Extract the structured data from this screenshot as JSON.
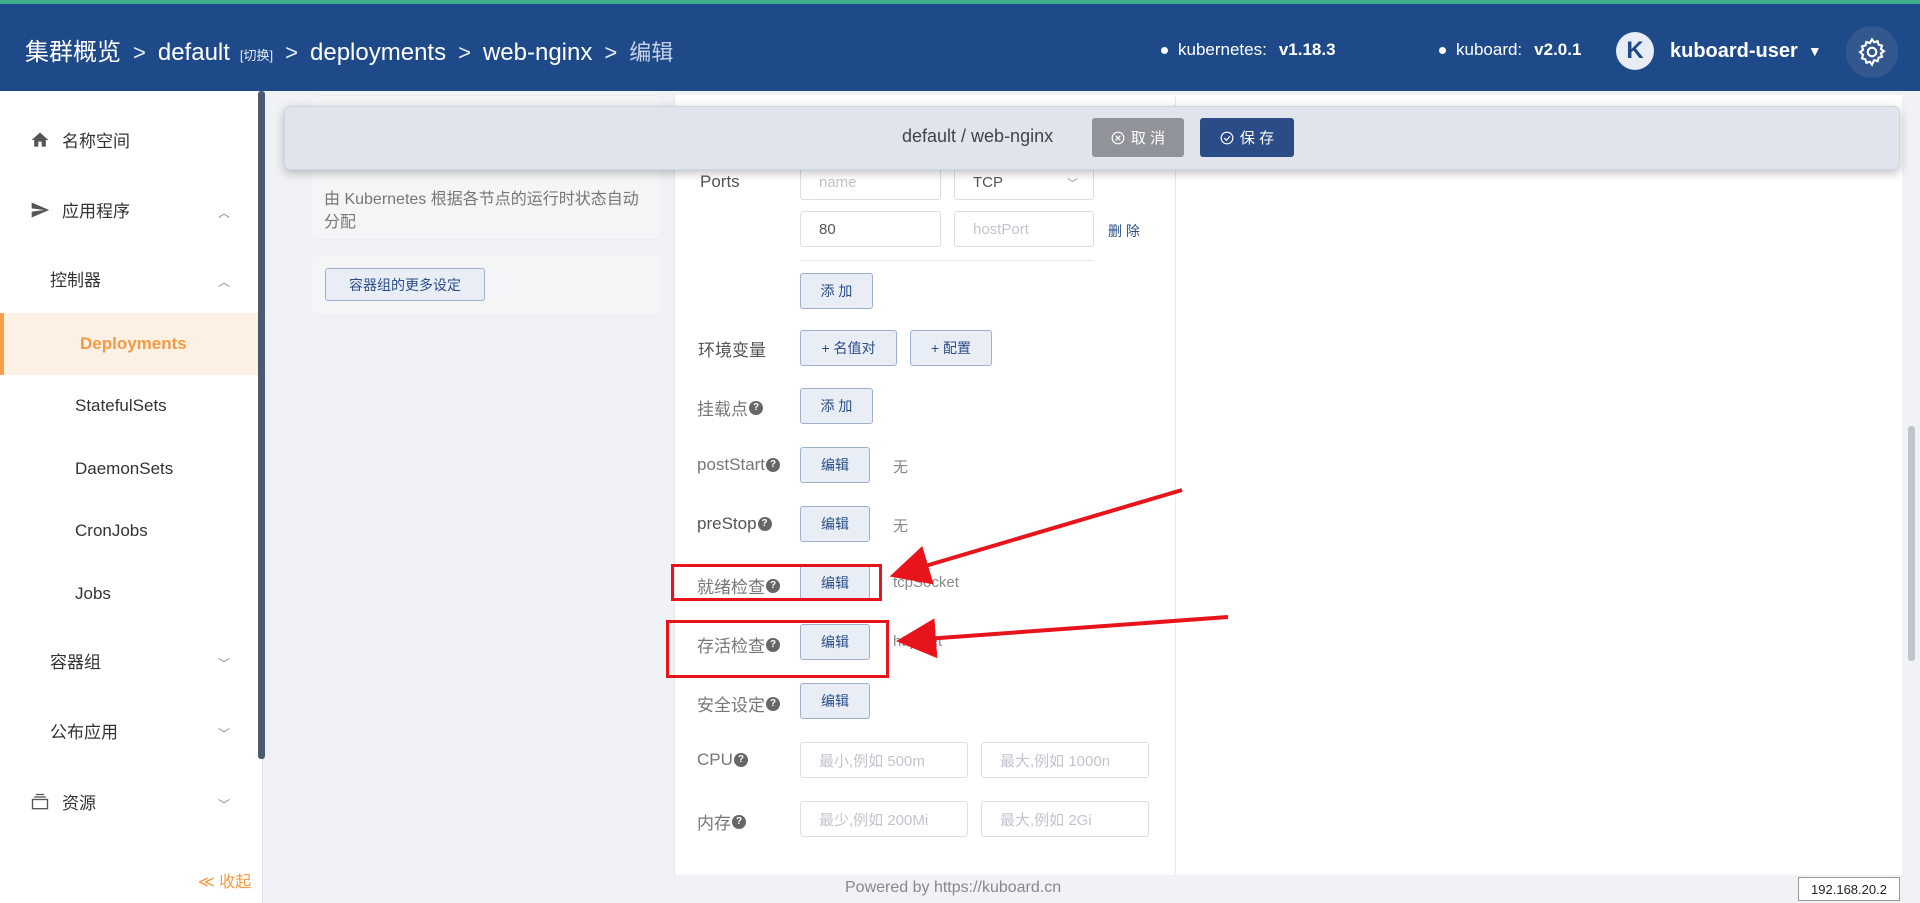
{
  "header": {
    "crumbs": [
      "集群概览",
      "default",
      "[切换]",
      "deployments",
      "web-nginx",
      "编辑"
    ],
    "k8s_label": "kubernetes:",
    "k8s_version": "v1.18.3",
    "kuboard_label": "kuboard:",
    "kuboard_version": "v2.0.1",
    "avatar_letter": "K",
    "user": "kuboard-user"
  },
  "sidebar": {
    "items": [
      {
        "label": "名称空间",
        "icon": "home-icon"
      },
      {
        "label": "应用程序",
        "icon": "send-icon"
      },
      {
        "label": "控制器"
      },
      {
        "label": "Deployments",
        "active": true
      },
      {
        "label": "StatefulSets"
      },
      {
        "label": "DaemonSets"
      },
      {
        "label": "CronJobs"
      },
      {
        "label": "Jobs"
      },
      {
        "label": "容器组"
      },
      {
        "label": "公布应用"
      },
      {
        "label": "资源",
        "icon": "layers-icon"
      }
    ],
    "collapse": "≪ 收起"
  },
  "topbar": {
    "title": "default / web-nginx",
    "cancel": "取 消",
    "save": "保 存"
  },
  "left_card": {
    "desc": "由 Kubernetes 根据各节点的运行时状态自动分配",
    "more_button": "容器组的更多设定"
  },
  "form": {
    "ports_label": "Ports",
    "port_name_placeholder": "name",
    "protocol": "TCP",
    "container_port": "80",
    "host_port_placeholder": "hostPort",
    "delete": "删 除",
    "add": "添 加",
    "env_label": "环境变量",
    "env_kv_button": "+ 名值对",
    "env_config_button": "+ 配置",
    "mount_label": "挂载点",
    "mount_add": "添 加",
    "poststart_label": "postStart",
    "prestop_label": "preStop",
    "readiness_label": "就绪检查",
    "liveness_label": "存活检查",
    "security_label": "安全设定",
    "edit_button": "编辑",
    "none": "无",
    "readiness_value": "tcpSocket",
    "liveness_value": "httpGet",
    "cpu_label": "CPU",
    "cpu_min_placeholder": "最小,例如 500m",
    "cpu_max_placeholder": "最大,例如 1000n",
    "mem_label": "内存",
    "mem_min_placeholder": "最少,例如 200Mi",
    "mem_max_placeholder": "最大,例如 2Gi",
    "help_mark": "?"
  },
  "footer": {
    "text": "Powered by https://kuboard.cn",
    "ip": "192.168.20.2"
  },
  "colors": {
    "header": "#1f4a8a",
    "accent": "#f39b43",
    "annotation": "#e8141c"
  }
}
